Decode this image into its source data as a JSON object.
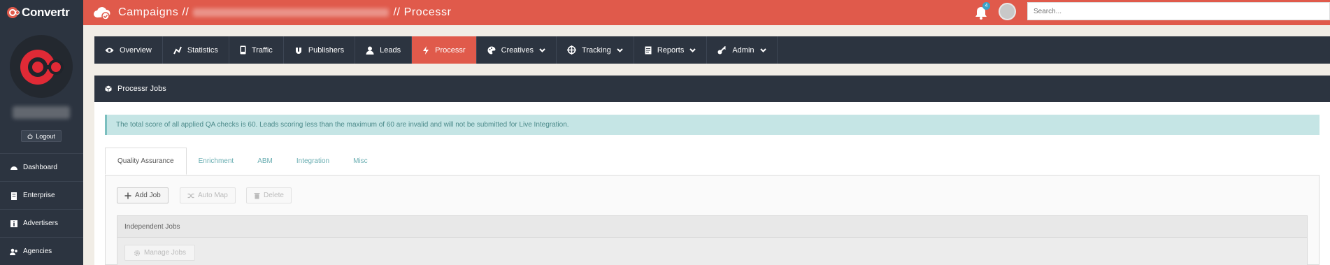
{
  "brand": {
    "name": "Convertr"
  },
  "header": {
    "crumb_prefix": "Campaigns //",
    "crumb_suffix": "// Processr",
    "notification_count": "4",
    "search_placeholder": "Search..."
  },
  "sidebar": {
    "logout_label": "Logout",
    "items": [
      {
        "label": "Dashboard",
        "icon": "dashboard-icon"
      },
      {
        "label": "Enterprise",
        "icon": "building-icon"
      },
      {
        "label": "Advertisers",
        "icon": "info-icon"
      },
      {
        "label": "Agencies",
        "icon": "users-icon"
      }
    ]
  },
  "nav": {
    "items": [
      {
        "label": "Overview",
        "icon": "eye-icon"
      },
      {
        "label": "Statistics",
        "icon": "chart-icon"
      },
      {
        "label": "Traffic",
        "icon": "mobile-icon"
      },
      {
        "label": "Publishers",
        "icon": "magnet-icon"
      },
      {
        "label": "Leads",
        "icon": "user-icon"
      },
      {
        "label": "Processr",
        "icon": "bolt-icon",
        "active": true
      },
      {
        "label": "Creatives",
        "icon": "palette-icon"
      },
      {
        "label": "Tracking",
        "icon": "crosshair-icon"
      },
      {
        "label": "Reports",
        "icon": "report-icon"
      },
      {
        "label": "Admin",
        "icon": "key-icon"
      }
    ]
  },
  "panel": {
    "title": "Processr Jobs",
    "alert": "The total score of all applied QA checks is 60. Leads scoring less than the maximum of 60 are invalid and will not be submitted for Live Integration.",
    "tabs": [
      "Quality Assurance",
      "Enrichment",
      "ABM",
      "Integration",
      "Misc"
    ],
    "buttons": {
      "add": "Add Job",
      "automap": "Auto Map",
      "delete": "Delete"
    },
    "independent_jobs": "Independent Jobs",
    "manage_jobs": "Manage Jobs"
  },
  "colors": {
    "accent": "#e05a4b",
    "dark": "#2c3440",
    "alert_bg": "#c5e5e5",
    "alert_text": "#4b8a8a"
  }
}
